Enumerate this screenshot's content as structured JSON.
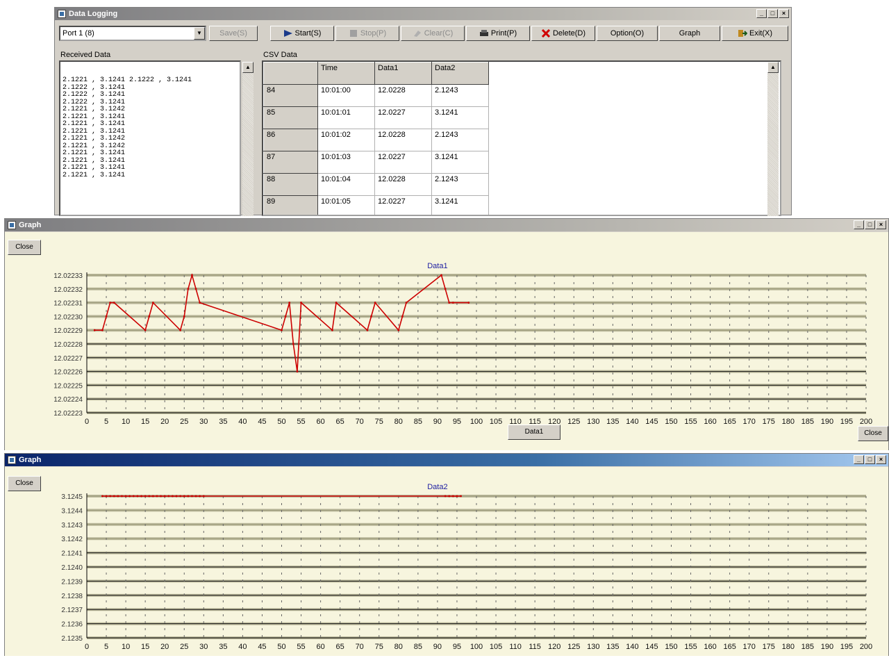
{
  "logging_window": {
    "title": "Data Logging",
    "port_value": "Port 1 (8)",
    "toolbar": {
      "save_label": "Save(S)",
      "start_label": "Start(S)",
      "stop_label": "Stop(P)",
      "clear_label": "Clear(C)",
      "print_label": "Print(P)",
      "delete_label": "Delete(D)",
      "option_label": "Option(O)",
      "graph_label": "Graph",
      "exit_label": "Exit(X)"
    },
    "received_label": "Received Data",
    "received_lines": [
      "2.1221 , 3.1241 2.1222 , 3.1241",
      "2.1222 , 3.1241",
      "2.1222 , 3.1241",
      "2.1222 , 3.1241",
      "2.1221 , 3.1242",
      "2.1221 , 3.1241",
      "2.1221 , 3.1241",
      "2.1221 , 3.1241",
      "2.1221 , 3.1242",
      "2.1221 , 3.1242",
      "2.1221 , 3.1241",
      "2.1221 , 3.1241",
      "2.1221 , 3.1241",
      "2.1221 , 3.1241"
    ],
    "csv_label": "CSV Data",
    "table_headers": [
      "",
      "Time",
      "Data1",
      "Data2"
    ],
    "table_rows": [
      [
        "84",
        "10:01:00",
        "12.0228",
        "2.1243"
      ],
      [
        "85",
        "10:01:01",
        "12.0227",
        "3.1241"
      ],
      [
        "86",
        "10:01:02",
        "12.0228",
        "2.1243"
      ],
      [
        "87",
        "10:01:03",
        "12.0227",
        "3.1241"
      ],
      [
        "88",
        "10:01:04",
        "12.0228",
        "2.1243"
      ],
      [
        "89",
        "10:01:05",
        "12.0227",
        "3.1241"
      ]
    ]
  },
  "graph1": {
    "title": "Graph",
    "close_label": "Close",
    "bottom_button": "Data1",
    "side_button": "Close",
    "ytick_labels": [
      "12.02233",
      "12.02232",
      "12.02231",
      "12.02230",
      "12.02229",
      "12.02228",
      "12.02227",
      "12.02226",
      "12.02225",
      "12.02224",
      "12.02223"
    ]
  },
  "graph2": {
    "title": "Graph",
    "close_label": "Close",
    "ytick_labels": [
      "3.1245",
      "3.1244",
      "3.1243",
      "3.1242",
      "2.1241",
      "2.1240",
      "2.1239",
      "2.1238",
      "2.1237",
      "2.1236",
      "2.1235"
    ]
  },
  "chart_data": [
    {
      "type": "line",
      "title": "Data1",
      "xlim": [
        0,
        200
      ],
      "xticks": [
        0,
        5,
        10,
        15,
        20,
        25,
        30,
        35,
        40,
        45,
        50,
        55,
        60,
        65,
        70,
        75,
        80,
        85,
        90,
        95,
        100,
        105,
        110,
        115,
        120,
        125,
        130,
        135,
        140,
        145,
        150,
        155,
        160,
        165,
        170,
        175,
        180,
        185,
        190,
        195,
        200
      ],
      "grid": true,
      "series": [
        {
          "color": "#cc0000",
          "x": [
            2,
            4,
            5,
            6,
            7,
            15,
            16,
            17,
            24,
            25,
            26,
            27,
            28,
            29,
            50,
            51,
            52,
            53,
            54,
            55,
            63,
            64,
            72,
            73,
            74,
            80,
            81,
            82,
            91,
            92,
            93,
            94,
            98
          ],
          "y": [
            12.02229,
            12.02229,
            12.0223,
            12.02231,
            12.02231,
            12.02229,
            12.0223,
            12.02231,
            12.02229,
            12.0223,
            12.02232,
            12.02233,
            12.02232,
            12.02231,
            12.02229,
            12.0223,
            12.02231,
            12.02228,
            12.02226,
            12.02231,
            12.02229,
            12.02231,
            12.02229,
            12.0223,
            12.02231,
            12.02229,
            12.0223,
            12.02231,
            12.02233,
            12.02232,
            12.02231,
            12.02231,
            12.02231
          ]
        }
      ]
    },
    {
      "type": "line",
      "title": "Data2",
      "xlim": [
        0,
        200
      ],
      "xticks": [
        0,
        5,
        10,
        15,
        20,
        25,
        30,
        35,
        40,
        45,
        50,
        55,
        60,
        65,
        70,
        75,
        80,
        85,
        90,
        95,
        100,
        105,
        110,
        115,
        120,
        125,
        130,
        135,
        140,
        145,
        150,
        155,
        160,
        165,
        170,
        175,
        180,
        185,
        190,
        195,
        200
      ],
      "grid": true,
      "series": [
        {
          "color": "#cc0000",
          "x": [
            4,
            5,
            6,
            7,
            8,
            9,
            10,
            11,
            12,
            13,
            14,
            15,
            16,
            17,
            18,
            19,
            20,
            21,
            22,
            23,
            24,
            25,
            26,
            27,
            28,
            29,
            30,
            92,
            93,
            94,
            95,
            96
          ],
          "y": [
            3.1245,
            3.1243,
            3.1245,
            3.1244,
            3.1243,
            3.1245,
            3.1244,
            3.1243,
            3.1245,
            3.1244,
            3.1243,
            3.1245,
            3.1244,
            3.1243,
            3.1245,
            3.1244,
            3.1243,
            3.1245,
            3.1244,
            3.1243,
            3.1245,
            3.1244,
            3.1243,
            3.1245,
            3.1244,
            3.1243,
            3.1245,
            3.1245,
            3.1243,
            3.1242,
            3.1243,
            3.1245
          ]
        }
      ]
    }
  ]
}
